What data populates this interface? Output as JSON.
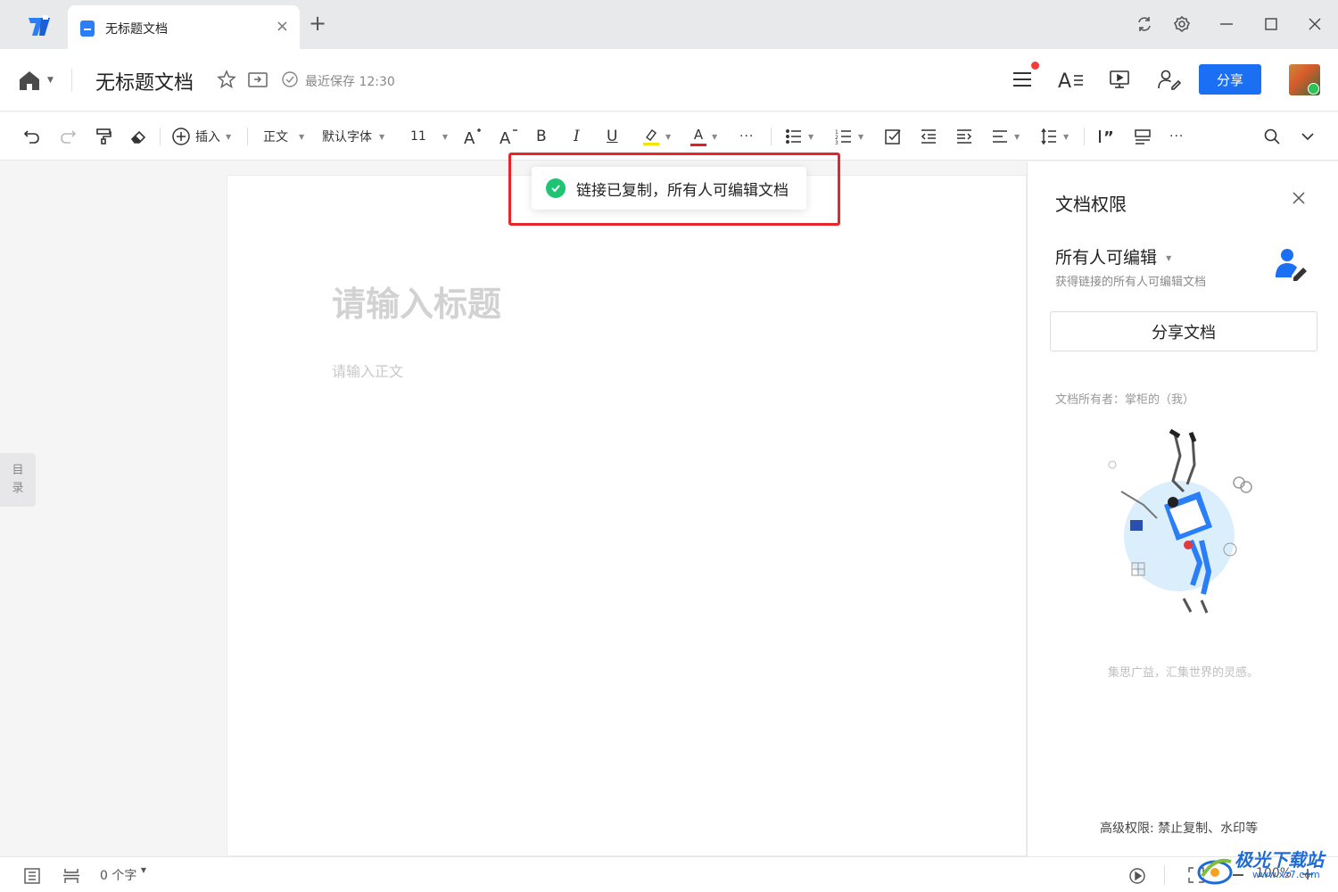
{
  "tabbar": {
    "tab_title": "无标题文档",
    "close_glyph": "×",
    "add_glyph": "+"
  },
  "header": {
    "doc_title": "无标题文档",
    "save_status": "最近保存 12:30",
    "share_label": "分享"
  },
  "toolbar": {
    "insert_label": "插入",
    "style_label": "正文",
    "font_label": "默认字体",
    "size_label": "11",
    "bold": "B",
    "italic": "I",
    "underline": "U",
    "font_color_glyph": "A",
    "more_glyph": "···"
  },
  "editor": {
    "title_placeholder": "请输入标题",
    "body_placeholder": "请输入正文",
    "toc_label_1": "目",
    "toc_label_2": "录"
  },
  "toast": {
    "message": "链接已复制，所有人可编辑文档"
  },
  "panel": {
    "title": "文档权限",
    "permission_label": "所有人可编辑",
    "permission_desc": "获得链接的所有人可编辑文档",
    "share_doc_label": "分享文档",
    "owner_text": "文档所有者：掌柜的（我）",
    "slogan": "集思广益，汇集世界的灵感。",
    "advanced_label": "高级权限: 禁止复制、水印等"
  },
  "statusbar": {
    "word_count": "0 个字",
    "zoom": "100%"
  },
  "watermark": {
    "name": "极光下载站",
    "url": "www.xz7.com"
  },
  "colors": {
    "accent": "#1a6ff2",
    "toast_check": "#1ec474",
    "highlight_box": "#e8262a",
    "notification_dot": "#f23c3c",
    "highlight_color": "#f5e400",
    "font_color": "#e02020"
  }
}
